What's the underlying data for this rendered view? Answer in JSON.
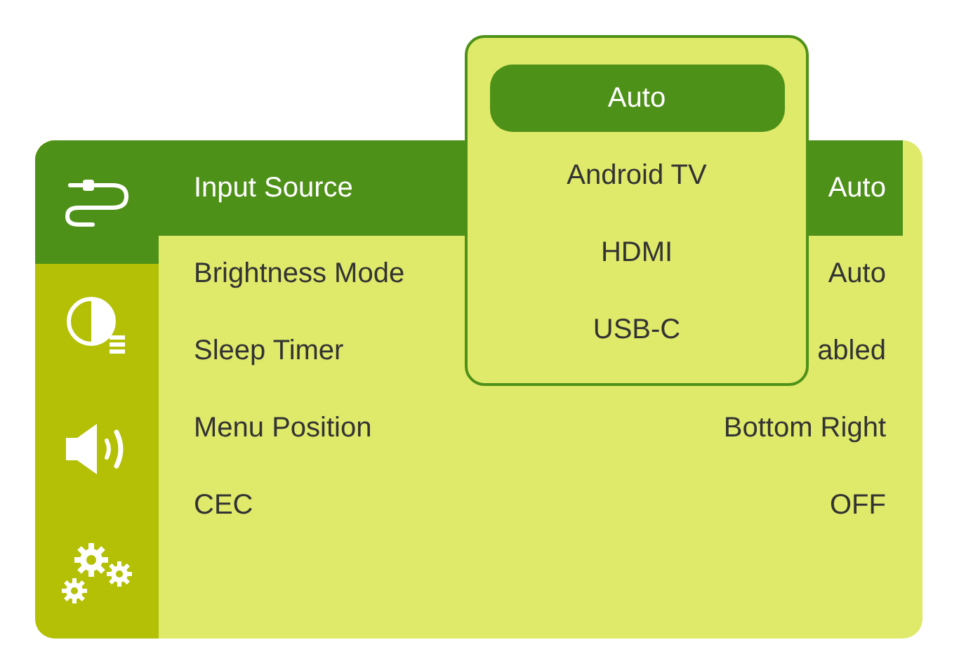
{
  "sidebar": {
    "items": [
      {
        "kind": "input",
        "selected": true
      },
      {
        "kind": "picture",
        "selected": false
      },
      {
        "kind": "sound",
        "selected": false
      },
      {
        "kind": "settings",
        "selected": false
      }
    ]
  },
  "settings": [
    {
      "label": "Input Source",
      "value": "Auto",
      "selected": true
    },
    {
      "label": "Brightness Mode",
      "value": "Auto",
      "selected": false
    },
    {
      "label": "Sleep Timer",
      "value": "abled",
      "selected": false
    },
    {
      "label": "Menu Position",
      "value": "Bottom Right",
      "selected": false
    },
    {
      "label": "CEC",
      "value": "OFF",
      "selected": false
    }
  ],
  "dropdown": {
    "options": [
      {
        "label": "Auto",
        "selected": true
      },
      {
        "label": "Android TV",
        "selected": false
      },
      {
        "label": "HDMI",
        "selected": false
      },
      {
        "label": "USB-C",
        "selected": false
      }
    ]
  }
}
